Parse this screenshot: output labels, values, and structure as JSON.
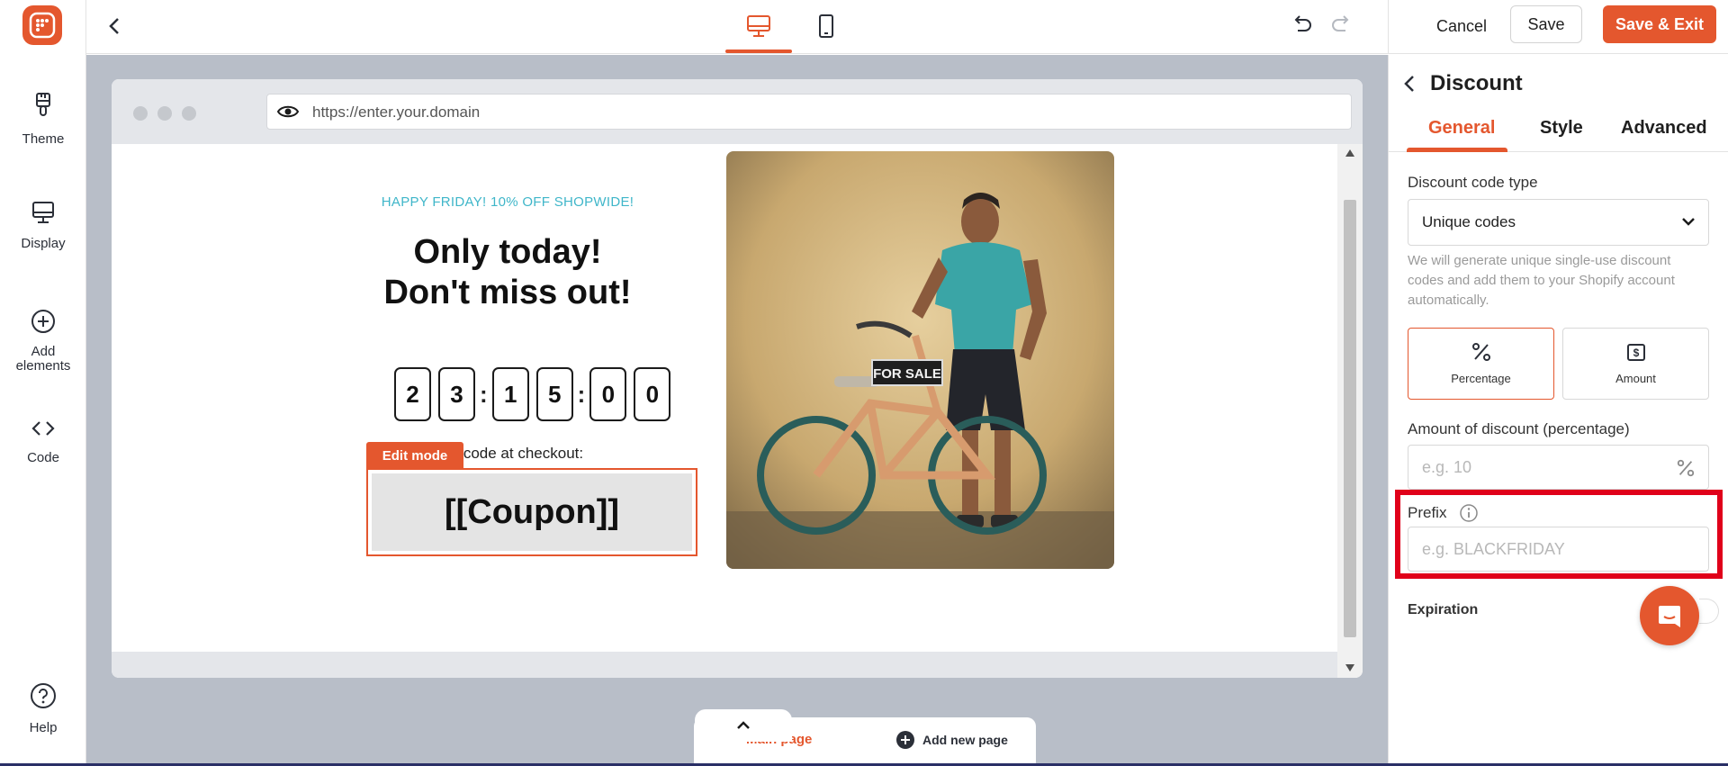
{
  "sidebar": {
    "items": [
      {
        "label": "Theme",
        "icon": "brush-icon"
      },
      {
        "label": "Display",
        "icon": "monitor-icon"
      },
      {
        "label": "Add\nelements",
        "icon": "plus-circle-icon"
      },
      {
        "label": "Code",
        "icon": "code-icon"
      }
    ],
    "help_label": "Help"
  },
  "toolbar": {
    "cancel_label": "Cancel",
    "save_label": "Save",
    "save_exit_label": "Save & Exit",
    "active_device": "desktop"
  },
  "browser": {
    "url": "https://enter.your.domain"
  },
  "popup": {
    "tagline": "HAPPY FRIDAY! 10% OFF SHOPWIDE!",
    "headline_line1": "Only today!",
    "headline_line2": "Don't miss out!",
    "countdown": [
      "2",
      "3",
      "1",
      "5",
      "0",
      "0"
    ],
    "use_code_text": "Use code at checkout:",
    "edit_mode_label": "Edit mode",
    "coupon_text": "[[Coupon]]",
    "image_sign": "FOR SALE"
  },
  "pages": {
    "main_tab": "Main page",
    "add_tab": "Add new page"
  },
  "panel": {
    "title": "Discount",
    "tabs": [
      "General",
      "Style",
      "Advanced"
    ],
    "active_tab": "General",
    "code_type_label": "Discount code type",
    "code_type_value": "Unique codes",
    "code_type_help": "We will generate unique single-use discount codes and add them to your Shopify account automatically.",
    "discount_types": [
      {
        "label": "Percentage",
        "icon": "percent-icon",
        "selected": true
      },
      {
        "label": "Amount",
        "icon": "dollar-icon",
        "selected": false
      }
    ],
    "amount_label": "Amount of discount (percentage)",
    "amount_placeholder": "e.g. 10",
    "prefix_label": "Prefix",
    "prefix_placeholder": "e.g. BLACKFRIDAY",
    "expiration_label": "Expiration"
  },
  "colors": {
    "accent": "#e4572e",
    "highlight": "#e0001a",
    "tagline": "#3fb6c9"
  }
}
